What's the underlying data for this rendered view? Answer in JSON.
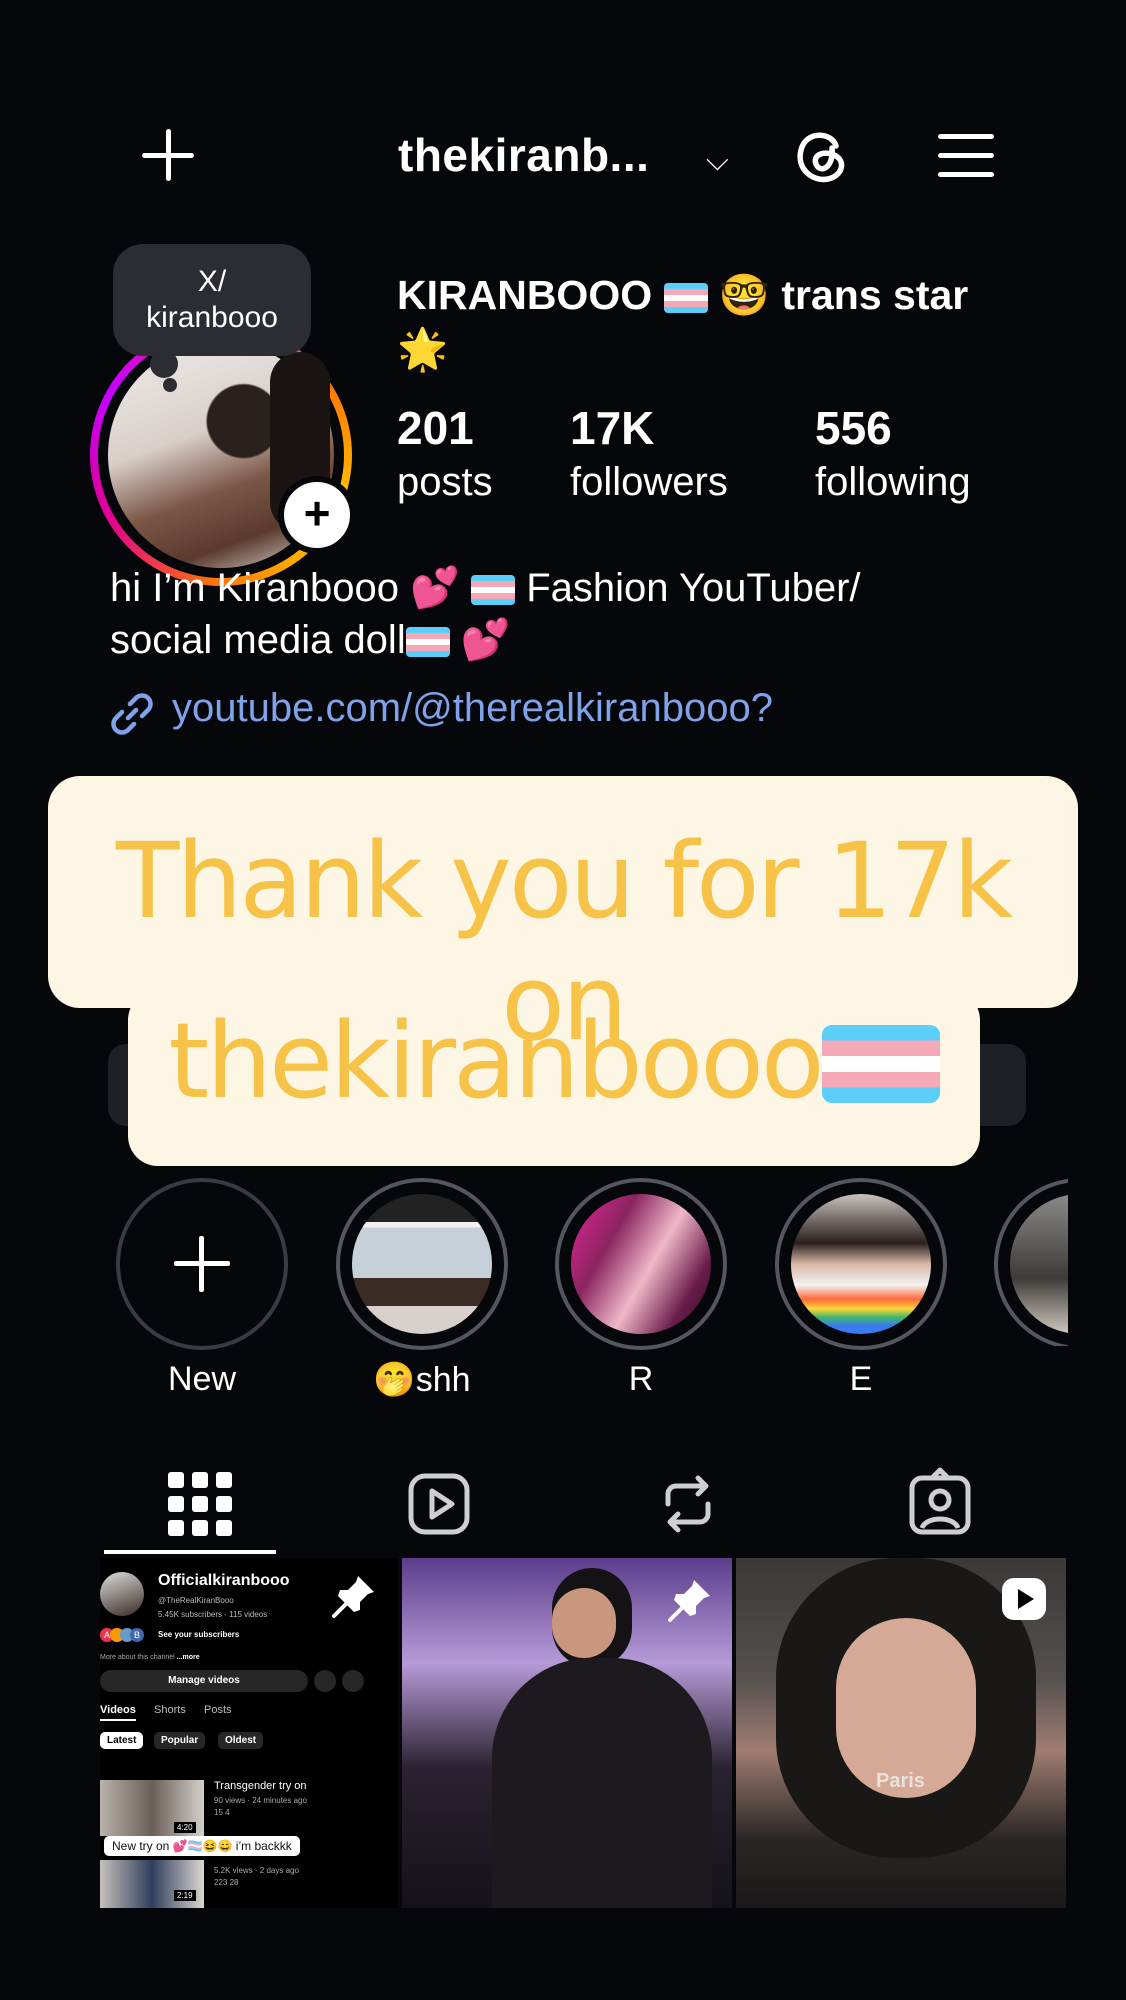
{
  "header": {
    "username": "thekiranb...",
    "chevron": "chevron-down-icon",
    "create_icon": "plus-icon",
    "threads_icon": "threads-icon",
    "menu_icon": "hamburger-menu-icon"
  },
  "profile": {
    "note_line1": "X/",
    "note_line2": "kiranbooo",
    "display_name_part1": "KIRANBOOO",
    "display_name_part2": "🤓 trans star",
    "display_name_part3": "🌟",
    "stats": {
      "posts_count": "201",
      "posts_label": "posts",
      "followers_count": "17K",
      "followers_label": "followers",
      "following_count": "556",
      "following_label": "following"
    },
    "bio_line1_a": "hi I’m Kiranbooo 💕",
    "bio_line1_b": "Fashion YouTuber/",
    "bio_line2_a": "social media doll",
    "bio_line2_b": "💕",
    "link": "youtube.com/@therealkiranbooo?"
  },
  "overlay": {
    "line1": "Thank you for 17k on",
    "line2": "thekiranbooo"
  },
  "highlights": [
    {
      "label": "New"
    },
    {
      "label": "🤭shh"
    },
    {
      "label": "R"
    },
    {
      "label": "E"
    },
    {
      "label": ""
    }
  ],
  "tabs": [
    "grid-icon",
    "reels-icon",
    "reposts-icon",
    "tagged-icon"
  ],
  "grid": {
    "yt": {
      "channel_name": "Officialkiranbooo",
      "handle": "@TheRealKiranBooo",
      "meta": "5.45K subscribers · 115 videos",
      "see_subs": "See your subscribers",
      "about": "More about this channel",
      "about_more": "...more",
      "manage": "Manage videos",
      "tab_videos": "Videos",
      "tab_shorts": "Shorts",
      "tab_posts": "Posts",
      "filter_latest": "Latest",
      "filter_popular": "Popular",
      "filter_oldest": "Oldest",
      "video1_title": "Transgender try on",
      "video1_meta": "90 views · 24 minutes ago",
      "video1_stats": "15  4",
      "video1_duration": "4:20",
      "caption": "New try on 💕🏳️‍⚧️😆😄 i’m backkk",
      "video2_meta": "5.2K views · 2 days ago",
      "video2_stats": "223  28",
      "video2_duration": "2:19",
      "avatars": [
        "A",
        "B"
      ]
    },
    "c3_caption": "Paris"
  }
}
